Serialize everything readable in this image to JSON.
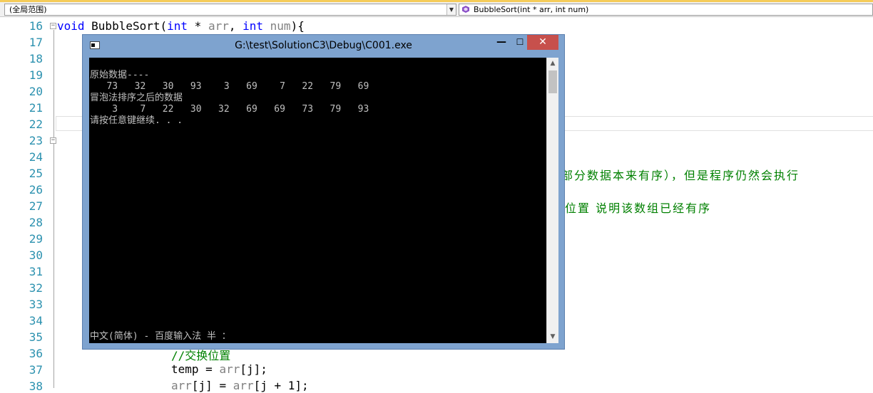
{
  "navbar": {
    "scope_value": "(全局范围)",
    "member_value": "BubbleSort(int * arr, int num)"
  },
  "editor": {
    "line_numbers": [
      "16",
      "17",
      "18",
      "19",
      "20",
      "21",
      "22",
      "23",
      "24",
      "25",
      "26",
      "27",
      "28",
      "29",
      "30",
      "31",
      "32",
      "33",
      "34",
      "35",
      "36",
      "37",
      "38"
    ],
    "line16": {
      "kw1": "void",
      "name": " BubbleSort(",
      "kw2": "int",
      "mid": " * ",
      "p1": "arr",
      "sep": ", ",
      "kw3": "int",
      "sp": " ",
      "p2": "num",
      "end": "){"
    },
    "line25_comment": "部分数据本来有序），但是程序仍然会执行",
    "line27_comment": "位置 说明该数组已经有序",
    "line36_comment": "//交换位置",
    "line37": {
      "a": "temp = ",
      "p": "arr",
      "b": "[j];"
    },
    "line38": {
      "p1": "arr",
      "a": "[j] = ",
      "p2": "arr",
      "b": "[j + 1];"
    }
  },
  "console": {
    "title": "G:\\test\\SolutionC3\\Debug\\C001.exe",
    "buttons": {
      "minimize": "—",
      "maximize": "☐",
      "close": "✕"
    },
    "lines": [
      "原始数据----",
      "   73   32   30   93    3   69    7   22   79   69",
      "冒泡法排序之后的数据",
      "    3    7   22   30   32   69   69   73   79   93",
      "请按任意键继续. . ."
    ],
    "ime_status": "中文(简体) - 百度输入法 半 ："
  },
  "colors": {
    "keyword": "#0000ff",
    "parameter": "#808080",
    "comment": "#008000",
    "line_number": "#2b91af",
    "console_bg": "#000000",
    "console_text": "#c0c0c0",
    "window_frame": "#7ea3cf",
    "close_button": "#c7504c"
  }
}
